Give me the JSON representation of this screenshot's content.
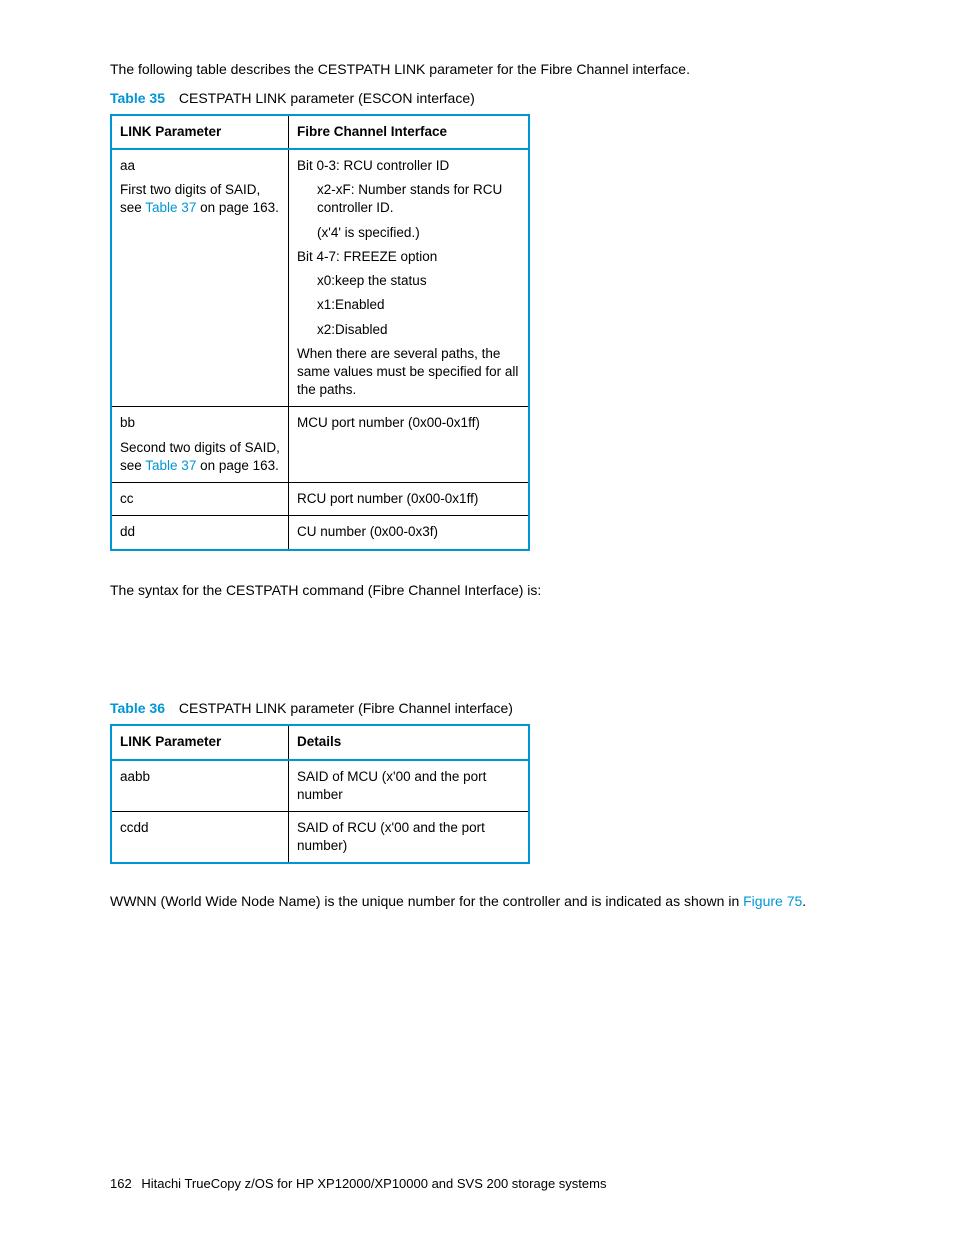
{
  "intro_para": "The following table describes the CESTPATH LINK parameter for the Fibre Channel interface.",
  "table35": {
    "label": "Table 35",
    "caption": "CESTPATH LINK parameter (ESCON interface)",
    "head_col1": "LINK Parameter",
    "head_col2": "Fibre Channel Interface",
    "row_aa_code": "aa",
    "row_aa_desc_pre": "First two digits of SAID, see ",
    "row_aa_desc_link": "Table 37",
    "row_aa_desc_post": " on page 163.",
    "row_aa_right_l1": "Bit 0-3: RCU controller ID",
    "row_aa_right_i1a": "x2-xF: Number stands for RCU controller ID.",
    "row_aa_right_i1b": "(x'4' is specified.)",
    "row_aa_right_l2": "Bit 4-7: FREEZE option",
    "row_aa_right_i2a": "x0:keep the status",
    "row_aa_right_i2b": "x1:Enabled",
    "row_aa_right_i2c": "x2:Disabled",
    "row_aa_right_l3": "When there are several paths, the same values must be specified for all the paths.",
    "row_bb_code": "bb",
    "row_bb_desc_pre": "Second two digits of SAID, see ",
    "row_bb_desc_link": "Table 37",
    "row_bb_desc_post": " on page 163.",
    "row_bb_right": "MCU port number (0x00-0x1ff)",
    "row_cc_code": "cc",
    "row_cc_right": "RCU port number (0x00-0x1ff)",
    "row_dd_code": "dd",
    "row_dd_right": "CU number (0x00-0x3f)"
  },
  "mid_para": "The syntax for the CESTPATH command (Fibre Channel Interface) is:",
  "table36": {
    "label": "Table 36",
    "caption": "CESTPATH LINK parameter (Fibre Channel interface)",
    "head_col1": "LINK Parameter",
    "head_col2": "Details",
    "row1_c1": "aabb",
    "row1_c2": "SAID of MCU (x'00 and the port number",
    "row2_c1": "ccdd",
    "row2_c2": "SAID of RCU (x'00 and the port number)"
  },
  "end_para_pre": "WWNN (World Wide Node Name) is the unique number for the controller and is indicated as shown in ",
  "end_para_link": "Figure 75",
  "end_para_post": ".",
  "footer_page": "162",
  "footer_text": "Hitachi TrueCopy z/OS for HP XP12000/XP10000 and SVS 200 storage systems"
}
